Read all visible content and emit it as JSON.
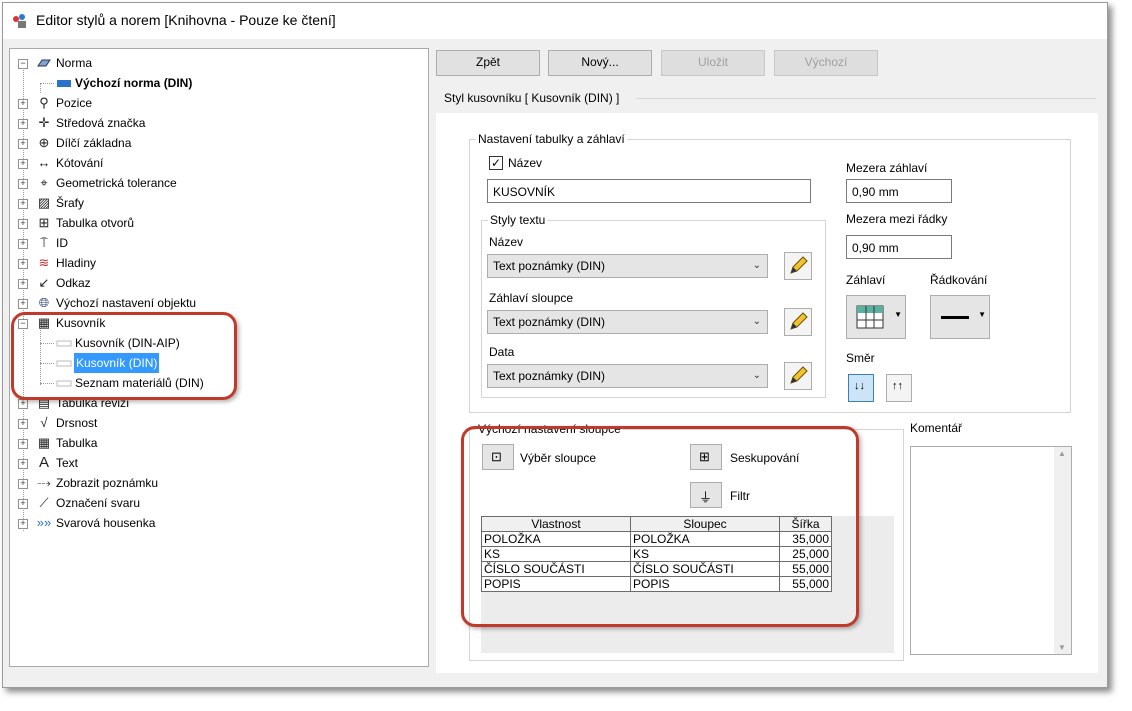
{
  "window": {
    "title": "Editor stylů a norem [Knihovna - Pouze ke čtení]"
  },
  "tree": {
    "items": [
      {
        "label": "Norma",
        "icon": "norm-icon"
      },
      {
        "label": "Výchozí norma (DIN)",
        "icon": "standard-icon"
      },
      {
        "label": "Pozice",
        "icon": "balloon-icon"
      },
      {
        "label": "Středová značka",
        "icon": "center-mark-icon"
      },
      {
        "label": "Dílčí základna",
        "icon": "datum-target-icon"
      },
      {
        "label": "Kótování",
        "icon": "dimension-icon"
      },
      {
        "label": "Geometrická tolerance",
        "icon": "feature-control-frame-icon"
      },
      {
        "label": "Šrafy",
        "icon": "hatch-icon"
      },
      {
        "label": "Tabulka otvorů",
        "icon": "hole-table-icon"
      },
      {
        "label": "ID",
        "icon": "id-icon"
      },
      {
        "label": "Hladiny",
        "icon": "layers-icon"
      },
      {
        "label": "Odkaz",
        "icon": "leader-icon"
      },
      {
        "label": "Výchozí nastavení objektu",
        "icon": "object-defaults-icon"
      },
      {
        "label": "Kusovník",
        "icon": "parts-list-icon"
      },
      {
        "label": "Kusovník (DIN-AIP)",
        "icon": "style-icon"
      },
      {
        "label": "Kusovník (DIN)",
        "icon": "style-icon"
      },
      {
        "label": "Seznam materiálů (DIN)",
        "icon": "style-icon"
      },
      {
        "label": "Tabulka revizí",
        "icon": "revision-table-icon"
      },
      {
        "label": "Drsnost",
        "icon": "surface-texture-icon"
      },
      {
        "label": "Tabulka",
        "icon": "table-icon"
      },
      {
        "label": "Text",
        "icon": "text-icon"
      },
      {
        "label": "Zobrazit poznámku",
        "icon": "view-annotation-icon"
      },
      {
        "label": "Označení svaru",
        "icon": "weld-symbol-icon"
      },
      {
        "label": "Svarová housenka",
        "icon": "weld-bead-icon"
      }
    ]
  },
  "toolbar": {
    "back": "Zpět",
    "new": "Nový...",
    "save": "Uložit",
    "default": "Výchozí"
  },
  "style_header": "Styl kusovníku [ Kusovník (DIN) ]",
  "table_settings": {
    "group_title": "Nastavení tabulky a záhlaví",
    "title_checkbox_label": "Název",
    "title_checked": true,
    "title_value": "KUSOVNÍK",
    "heading_gap_label": "Mezera záhlaví",
    "heading_gap_value": "0,90 mm",
    "line_spacing_label": "Mezera mezi řádky",
    "line_spacing_value": "0,90 mm",
    "heading_label": "Záhlaví",
    "line_spacing2_label": "Řádkování",
    "direction_label": "Směr"
  },
  "text_styles": {
    "group_title": "Styly textu",
    "title_label": "Název",
    "title_value": "Text poznámky (DIN)",
    "column_header_label": "Záhlaví sloupce",
    "column_header_value": "Text poznámky (DIN)",
    "data_label": "Data",
    "data_value": "Text poznámky (DIN)"
  },
  "column_defaults": {
    "group_title": "Výchozí nastavení sloupce",
    "chooser_label": "Výběr sloupce",
    "group_label": "Seskupování",
    "filter_label": "Filtr",
    "headers": [
      "Vlastnost",
      "Sloupec",
      "Šířka"
    ],
    "rows": [
      [
        "POLOŽKA",
        "POLOŽKA",
        "35,000"
      ],
      [
        "KS",
        "KS",
        "25,000"
      ],
      [
        "ČÍSLO SOUČÁSTI",
        "ČÍSLO SOUČÁSTI",
        "55,000"
      ],
      [
        "POPIS",
        "POPIS",
        "55,000"
      ]
    ]
  },
  "comment": {
    "label": "Komentář"
  },
  "colors": {
    "highlight": "#c0392b",
    "selection": "#3399ff"
  }
}
